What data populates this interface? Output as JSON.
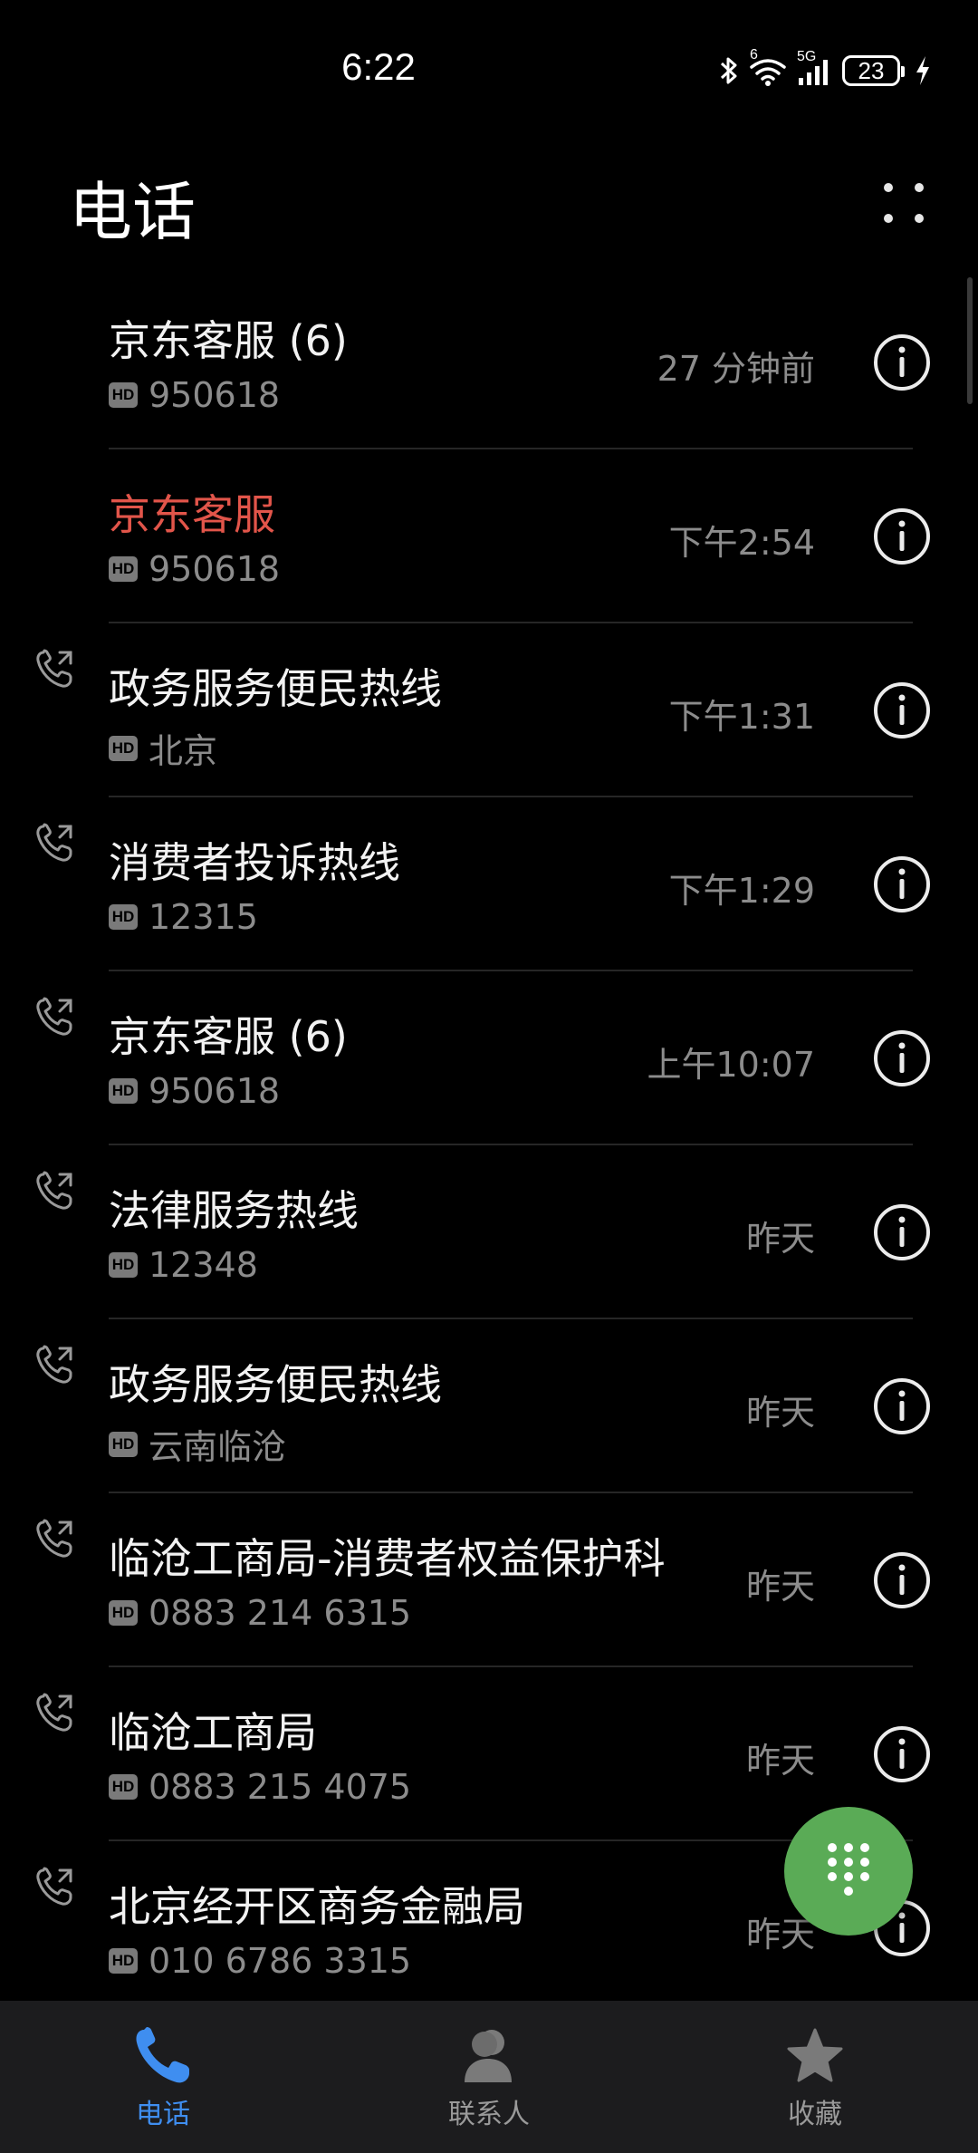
{
  "status_bar": {
    "time": "6:22",
    "network": "5G",
    "wifi_badge": "6",
    "battery": "23",
    "icons": [
      "bluetooth-icon",
      "wifi-icon",
      "signal-icon",
      "battery-icon",
      "charging-icon"
    ]
  },
  "header": {
    "title": "电话",
    "more_icon": "more-dots-icon"
  },
  "calls": [
    {
      "name": "京东客服 (6)",
      "sub": "950618",
      "time": "27 分钟前",
      "missed": false,
      "show_type_icon": false
    },
    {
      "name": "京东客服",
      "sub": "950618",
      "time": "下午2:54",
      "missed": true,
      "show_type_icon": false
    },
    {
      "name": "政务服务便民热线",
      "sub": "北京",
      "time": "下午1:31",
      "missed": false,
      "show_type_icon": true
    },
    {
      "name": "消费者投诉热线",
      "sub": "12315",
      "time": "下午1:29",
      "missed": false,
      "show_type_icon": true
    },
    {
      "name": "京东客服 (6)",
      "sub": "950618",
      "time": "上午10:07",
      "missed": false,
      "show_type_icon": true
    },
    {
      "name": "法律服务热线",
      "sub": "12348",
      "time": "昨天",
      "missed": false,
      "show_type_icon": true
    },
    {
      "name": "政务服务便民热线",
      "sub": "云南临沧",
      "time": "昨天",
      "missed": false,
      "show_type_icon": true
    },
    {
      "name": "临沧工商局-消费者权益保护科",
      "sub": "0883 214 6315",
      "time": "昨天",
      "missed": false,
      "show_type_icon": true
    },
    {
      "name": "临沧工商局",
      "sub": "0883 215 4075",
      "time": "昨天",
      "missed": false,
      "show_type_icon": true
    },
    {
      "name": "北京经开区商务金融局",
      "sub": "010 6786 3315",
      "time": "昨天",
      "missed": false,
      "show_type_icon": true
    }
  ],
  "hd_badge": "HD",
  "fab": {
    "icon": "dialpad-icon"
  },
  "bottom_nav": {
    "items": [
      {
        "label": "电话",
        "icon": "phone-icon",
        "active": true
      },
      {
        "label": "联系人",
        "icon": "contacts-icon",
        "active": false
      },
      {
        "label": "收藏",
        "icon": "star-icon",
        "active": false
      }
    ]
  },
  "colors": {
    "background": "#000000",
    "missed": "#e2554a",
    "accent": "#3f8ef0",
    "fab": "#5aab56",
    "nav_background": "#1c1c1e"
  }
}
